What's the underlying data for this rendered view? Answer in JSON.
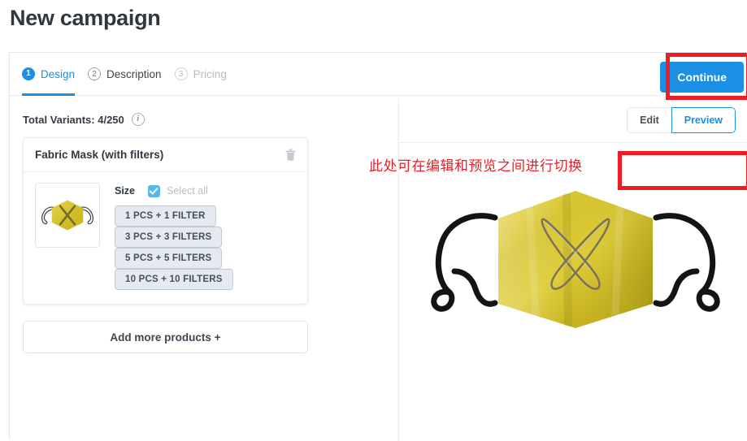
{
  "page": {
    "title": "New campaign"
  },
  "stepper": {
    "tabs": [
      {
        "num": "1",
        "label": "Design",
        "state": "active"
      },
      {
        "num": "2",
        "label": "Description",
        "state": "next"
      },
      {
        "num": "3",
        "label": "Pricing",
        "state": "disabled"
      }
    ]
  },
  "toolbar": {
    "continue_label": "Continue"
  },
  "variants": {
    "label": "Total Variants: 4/250",
    "info_glyph": "i"
  },
  "product_card": {
    "title": "Fabric Mask (with filters)",
    "delete_icon": "trash-icon",
    "thumbnail_alt": "yellow-fabric-mask-thumbnail",
    "options": {
      "label": "Size",
      "select_all_label": "Select all",
      "select_all_checked": true,
      "chips": [
        "1 PCS + 1 FILTER",
        "3 PCS + 3 FILTERS",
        "5 PCS + 5 FILTERS",
        "10 PCS + 10 FILTERS"
      ]
    }
  },
  "add_more": {
    "label": "Add more products +"
  },
  "preview": {
    "mode_buttons": [
      {
        "label": "Edit",
        "selected": false
      },
      {
        "label": "Preview",
        "selected": true
      }
    ],
    "image_alt": "yellow-fabric-mask-preview"
  },
  "annotations": {
    "toggle_note": "此处可在编辑和预览之间进行切换",
    "color": "#ee1c25"
  },
  "colors": {
    "accent_blue": "#1a8fe3",
    "chip_bg": "#e4eaf0",
    "mask_yellow": "#d8c42a",
    "annotation_red": "#ee1c25"
  }
}
